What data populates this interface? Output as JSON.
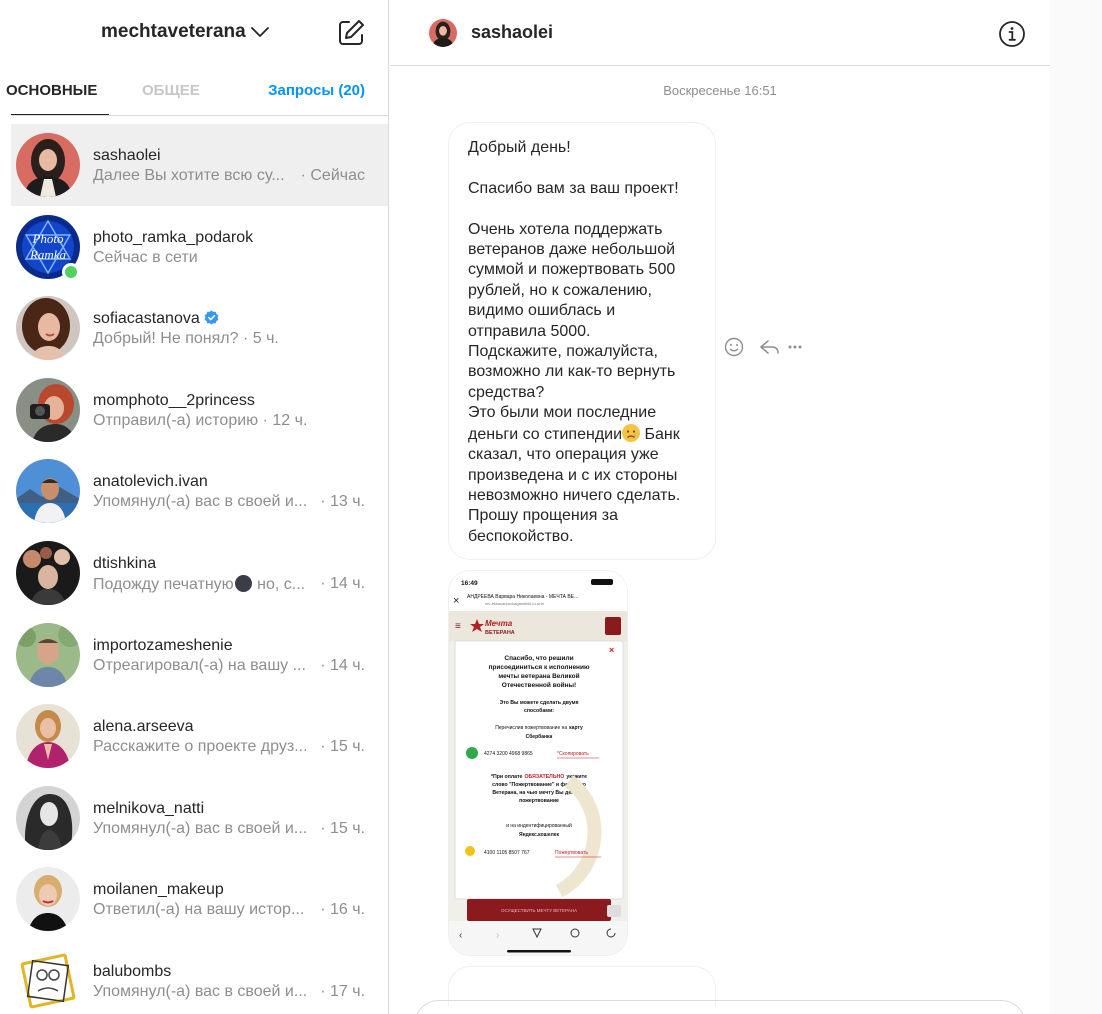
{
  "sidebar_header": {
    "account_name": "mechtaveterana",
    "chevron_icon": "chevron-down-icon",
    "compose_icon": "new-message-icon"
  },
  "tabs": {
    "main": "ОСНОВНЫЕ",
    "general": "ОБЩЕЕ",
    "requests": "Запросы (20)"
  },
  "conversations": [
    {
      "username": "sashaolei",
      "preview": "Далее Вы хотите всю су...",
      "time": "· Сейчас",
      "active": true
    },
    {
      "username": "photo_ramka_podarok",
      "preview": "Сейчас в сети",
      "time": "",
      "online": true,
      "avatar_text": [
        "Photo",
        "Ramka"
      ]
    },
    {
      "username": "sofiacastanova",
      "preview": "Добрый! Не понял? · 5 ч.",
      "time": "",
      "verified": true
    },
    {
      "username": "momphoto__2princess",
      "preview": "Отправил(-а) историю · 12 ч.",
      "time": ""
    },
    {
      "username": "anatolevich.ivan",
      "preview": "Упомянул(-а) вас в своей и...",
      "time": "· 13 ч."
    },
    {
      "username": "dtishkina",
      "preview_before": "Подожду печатную",
      "preview_after": " но, с...",
      "time": "· 14 ч."
    },
    {
      "username": "importozameshenie",
      "preview": "Отреагировал(-а) на вашу ...",
      "time": "· 14 ч."
    },
    {
      "username": "alena.arseeva",
      "preview": "Расскажите о проекте друз...",
      "time": "· 15 ч."
    },
    {
      "username": "melnikova_natti",
      "preview": "Упомянул(-а) вас в своей и...",
      "time": "· 15 ч."
    },
    {
      "username": "moilanen_makeup",
      "preview": "Ответил(-а) на вашу истор...",
      "time": "· 16 ч."
    },
    {
      "username": "balubombs",
      "preview": "Упомянул(-а) вас в своей и...",
      "time": "· 17 ч."
    }
  ],
  "chat_header": {
    "username": "sashaolei",
    "info_icon": "info-icon"
  },
  "thread": {
    "day_stamp": "Воскресенье 16:51",
    "message_before_emoji": "Добрый день!\n\nСпасибо вам за ваш проект!\n\nОчень хотела поддержать ветеранов даже небольшой суммой и пожертвовать 500 рублей, но к сожалению, видимо ошиблась и отправила 5000.\nПодскажите, пожалуйста, возможно ли как-то вернуть средства?\nЭто были мои последние деньги со стипендии",
    "message_after_emoji": " Банк сказал, что операция уже произведена и с их стороны невозможно ничего сделать.\nПрошу прощения за беспокойство.",
    "message_actions": [
      "emoji-react-icon",
      "reply-icon",
      "more-icon"
    ]
  },
  "attachment": {
    "status_time": "16:49",
    "browser_title": "АНДРЕЕВА Варвара Николаевна - МЕЧТА ВЕ...",
    "browser_url": "mv-ekkacarpuckagamkhill.ru-uria",
    "site_logo_line1": "Мечта",
    "site_logo_line2": "ВЕТЕРАНА",
    "modal_heading": [
      "Спасибо, что решили",
      "присоединиться к исполнению",
      "мечты ветерана Великой",
      "Отечественной войны!"
    ],
    "modal_ways": [
      "Это Вы можете сделать двумя",
      "способами:"
    ],
    "card_intro_before": "Перечислив пожертвование на",
    "card_intro_bold": "карту",
    "card_bank": "Сбербанка",
    "card_number": "4274 3200 4968 9865",
    "copy_label": "*Скопировать",
    "note_before": "*При оплате",
    "note_red": "ОБЯЗАТЕЛЬНО",
    "note_after_line1": "укажите",
    "note_lines": [
      "слово \"Пожертвование\" и фамилию",
      "Ветерана, на чью мечту Вы делаете",
      "пожертвование"
    ],
    "wallet_intro": "и на индентифицированный",
    "wallet_name": "Яндекс.кошелек",
    "wallet_number": "4100 1105 8507 767",
    "donate_label": "Пожертвовать",
    "bottom_button": "ОСУЩЕСТВИТЬ МЕЧТУ ВЕТЕРАНА"
  },
  "colors": {
    "accent_blue": "#0095f6",
    "online_green": "#52d160",
    "site_red": "#8b1a1f",
    "secondary_text": "#8e8e8e"
  }
}
